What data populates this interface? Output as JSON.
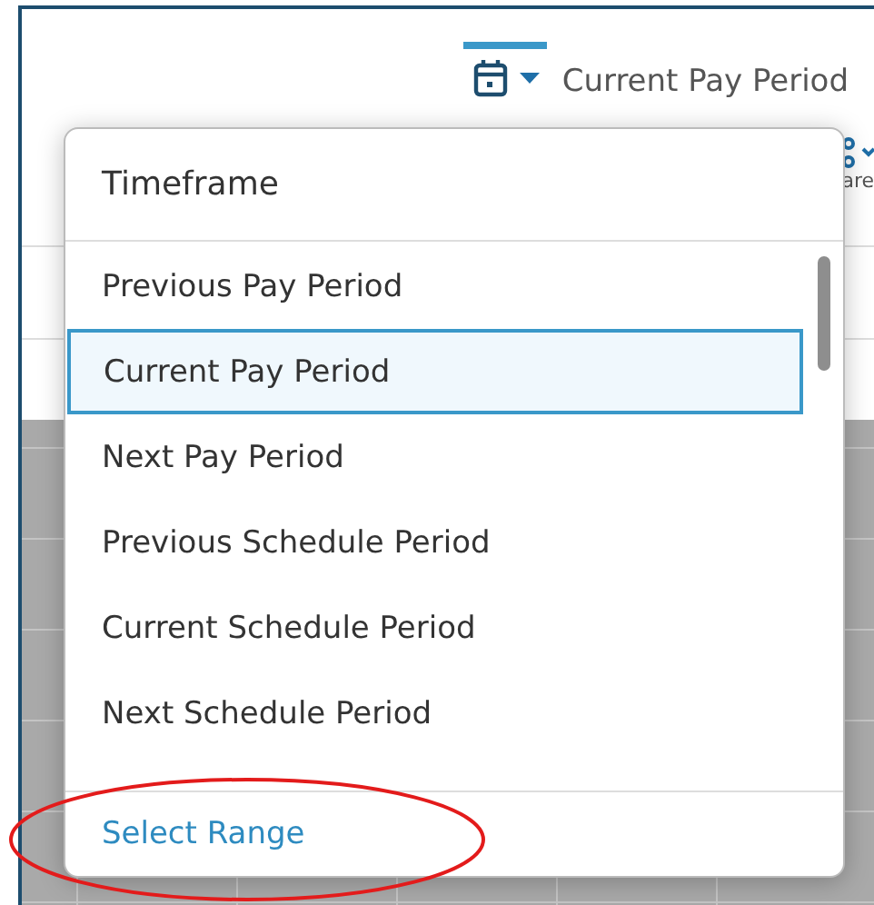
{
  "header": {
    "period_label": "Current Pay Period"
  },
  "side_tool": {
    "label": "are"
  },
  "timeframe_menu": {
    "title": "Timeframe",
    "options": [
      {
        "label": "Previous Pay Period",
        "selected": false
      },
      {
        "label": "Current Pay Period",
        "selected": true
      },
      {
        "label": "Next Pay Period",
        "selected": false
      },
      {
        "label": "Previous Schedule Period",
        "selected": false
      },
      {
        "label": "Current Schedule Period",
        "selected": false
      },
      {
        "label": "Next Schedule Period",
        "selected": false
      }
    ],
    "footer_link": "Select Range"
  },
  "annotation": {
    "kind": "ellipse"
  }
}
